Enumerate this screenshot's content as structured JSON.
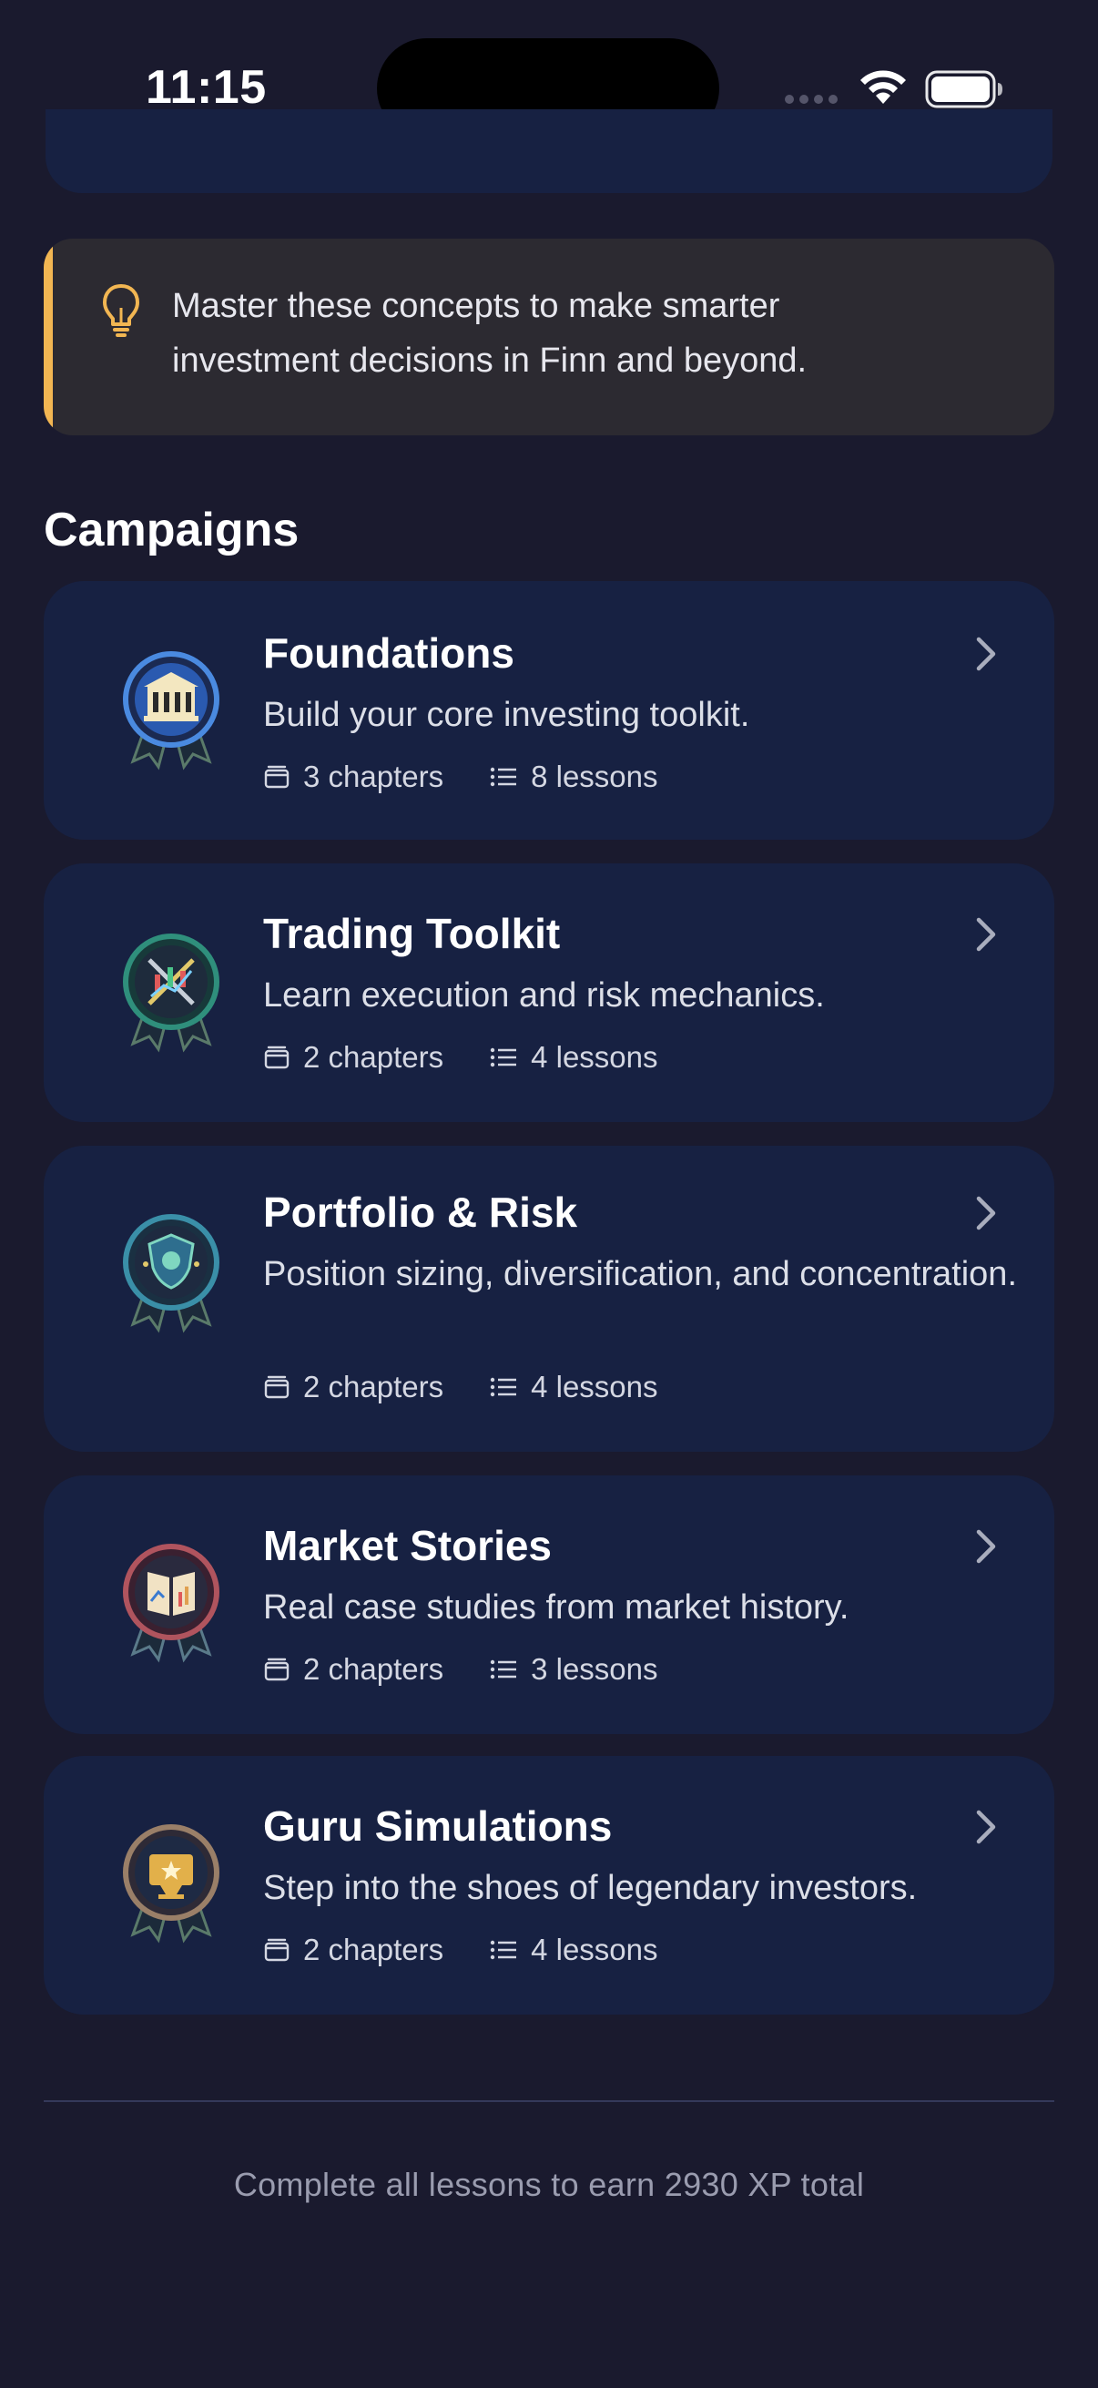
{
  "status_bar": {
    "time": "11:15"
  },
  "tip": {
    "text": "Master these concepts to make smarter investment decisions in Finn and beyond."
  },
  "section": {
    "title": "Campaigns"
  },
  "campaigns": [
    {
      "title": "Foundations",
      "description": "Build your core investing toolkit.",
      "chapters": "3 chapters",
      "lessons": "8 lessons",
      "badge_icon": "bank-badge-icon",
      "badge_color": "#3d7bd6"
    },
    {
      "title": "Trading Toolkit",
      "description": "Learn execution and risk mechanics.",
      "chapters": "2 chapters",
      "lessons": "4 lessons",
      "badge_icon": "chart-tools-badge-icon",
      "badge_color": "#2f8f7c"
    },
    {
      "title": "Portfolio & Risk",
      "description": "Position sizing, diversification, and concentration.",
      "chapters": "2 chapters",
      "lessons": "4 lessons",
      "badge_icon": "shield-badge-icon",
      "badge_color": "#3a8fa8"
    },
    {
      "title": "Market Stories",
      "description": "Real case studies from market history.",
      "chapters": "2 chapters",
      "lessons": "3 lessons",
      "badge_icon": "book-badge-icon",
      "badge_color": "#b0545e"
    },
    {
      "title": "Guru Simulations",
      "description": "Step into the shoes of legendary investors.",
      "chapters": "2 chapters",
      "lessons": "4 lessons",
      "badge_icon": "trophy-badge-icon",
      "badge_color": "#9a7f68"
    }
  ],
  "footer": {
    "text": "Complete all lessons to earn 2930 XP total"
  },
  "colors": {
    "background": "#1a1a2e",
    "card": "#172142",
    "tip_background": "#2c2a31",
    "accent": "#f2b652"
  }
}
